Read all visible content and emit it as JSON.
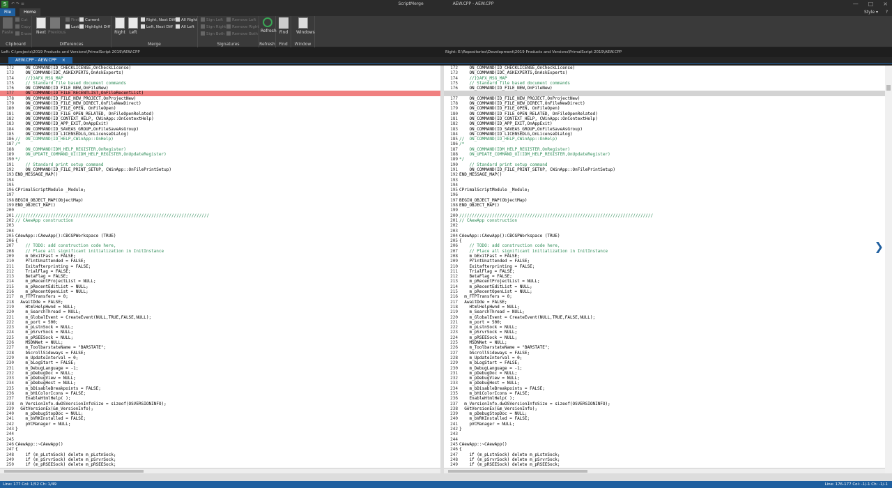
{
  "window": {
    "app_title": "ScriptMerge",
    "doc_title": "AEW.CPP - AEW.CPP",
    "qat": "↶ ↷ ≡"
  },
  "tabs": {
    "file": "File",
    "home": "Home",
    "style": "Style",
    "help": "?"
  },
  "ribbon": {
    "clipboard": {
      "label": "Clipboard",
      "paste": "Paste",
      "cut": "Cut",
      "copy": "Copy",
      "erase": "Erase"
    },
    "differences": {
      "label": "Differences",
      "next": "Next",
      "previous": "Previous",
      "first": "First",
      "last": "Last",
      "current": "Current",
      "highlight_diff": "Highlight Diff"
    },
    "merge": {
      "label": "Merge",
      "right": "Right",
      "left": "Left",
      "right_next_diff": "Right, Next Diff",
      "left_next_diff": "Left, Next Diff",
      "all_right": "All Right",
      "all_left": "All Left"
    },
    "signatures": {
      "label": "Signatures",
      "sign_left": "Sign Left",
      "sign_right": "Sign Right",
      "sign_both": "Sign Both",
      "remove_left": "Remove Left",
      "remove_right": "Remove Right",
      "remove_both": "Remove Both"
    },
    "refresh": {
      "label": "Refresh",
      "btn": "Refresh"
    },
    "find": {
      "label": "Find",
      "btn": "Find"
    },
    "window": {
      "label": "Window",
      "btn": "Windows"
    }
  },
  "paths": {
    "left": "Left: C:\\projects\\2019 Products and Versions\\PrimalScript 2019\\AEW.CPP",
    "right": "Right: E:\\Repositories\\Development\\2019 Products and Versions\\PrimalScript 2019\\AEW.CPP"
  },
  "doc_tab": {
    "label": "AEW.CPP - AEW.CPP",
    "close": "×"
  },
  "status": {
    "left": "Line: 177  Col: 1/52  Ch: 1/49",
    "right": "Line: 176-177  Col: -1/-1  Ch: -1/-1"
  },
  "left_lines": [
    {
      "n": "172",
      "t": "    ON_COMMAND(ID_CHECKLICENSE,OnCheckLicense)",
      "c": ""
    },
    {
      "n": "173",
      "t": "    ON_COMMAND(IDC_ASKEXPERTS,OnAskExperts)",
      "c": ""
    },
    {
      "n": "174",
      "t": "    //}}AFX_MSG_MAP",
      "c": "comment"
    },
    {
      "n": "175",
      "t": "    // Standard file based document commands",
      "c": "comment"
    },
    {
      "n": "176",
      "t": "    ON_COMMAND(ID_FILE_NEW,OnFileNew)",
      "c": ""
    },
    {
      "n": "177",
      "t": "    ON_COMMAND(ID_FILE_RECENTLIST,OnFileRecentList)",
      "c": "hl-red"
    },
    {
      "n": "178",
      "t": "    ON_COMMAND(ID_FILE_NEW_PROJECT,OnProjectNew)",
      "c": ""
    },
    {
      "n": "179",
      "t": "    ON_COMMAND(ID_FILE_NEW_DIRECT,OnFileNewDirect)",
      "c": ""
    },
    {
      "n": "180",
      "t": "    ON_COMMAND(ID_FILE_OPEN, OnFileOpen)",
      "c": ""
    },
    {
      "n": "181",
      "t": "    ON_COMMAND(ID_FILE_OPEN_RELATED, OnFileOpenRelated)",
      "c": ""
    },
    {
      "n": "182",
      "t": "    ON_COMMAND(ID_CONTEXT_HELP, CWinApp::OnContextHelp)",
      "c": ""
    },
    {
      "n": "183",
      "t": "    ON_COMMAND(ID_APP_EXIT,OnAppExit)",
      "c": ""
    },
    {
      "n": "184",
      "t": "    ON_COMMAND(ID_SAVEAS_GROUP,OnFileSaveAsGroup)",
      "c": ""
    },
    {
      "n": "185",
      "t": "    ON_COMMAND(ID_LICENSEDLG,OnLicenseDialog)",
      "c": ""
    },
    {
      "n": "186",
      "t": "//  ON_COMMAND(ID_HELP,CWinApp::OnHelp)",
      "c": "comment"
    },
    {
      "n": "187",
      "t": "/*",
      "c": "comment"
    },
    {
      "n": "188",
      "t": "    ON_COMMAND(IDM_HELP_REGISTER,OnRegister)",
      "c": "comment"
    },
    {
      "n": "189",
      "t": "    ON_UPDATE_COMMAND_UI(IDM_HELP_REGISTER,OnUpdateRegister)",
      "c": "comment"
    },
    {
      "n": "190",
      "t": "*/",
      "c": "comment"
    },
    {
      "n": "191",
      "t": "    // Standard print setup command",
      "c": "comment"
    },
    {
      "n": "192",
      "t": "    ON_COMMAND(ID_FILE_PRINT_SETUP, CWinApp::OnFilePrintSetup)",
      "c": ""
    },
    {
      "n": "193",
      "t": "END_MESSAGE_MAP()",
      "c": ""
    },
    {
      "n": "194",
      "t": "",
      "c": ""
    },
    {
      "n": "195",
      "t": "",
      "c": ""
    },
    {
      "n": "196",
      "t": "CPrimalScriptModule _Module;",
      "c": ""
    },
    {
      "n": "197",
      "t": "",
      "c": ""
    },
    {
      "n": "198",
      "t": "BEGIN_OBJECT_MAP(ObjectMap)",
      "c": ""
    },
    {
      "n": "199",
      "t": "END_OBJECT_MAP()",
      "c": ""
    },
    {
      "n": "200",
      "t": "",
      "c": ""
    },
    {
      "n": "201",
      "t": "/////////////////////////////////////////////////////////////////////////////",
      "c": "comment"
    },
    {
      "n": "202",
      "t": "// CAewApp construction",
      "c": "comment"
    },
    {
      "n": "203",
      "t": "",
      "c": ""
    },
    {
      "n": "204",
      "t": "",
      "c": ""
    },
    {
      "n": "205",
      "t": "CAewApp::CAewApp():CBCGPWorkspace (TRUE)",
      "c": ""
    },
    {
      "n": "206",
      "t": "{",
      "c": ""
    },
    {
      "n": "207",
      "t": "    // TODO: add construction code here,",
      "c": "comment"
    },
    {
      "n": "208",
      "t": "    // Place all significant initialization in InitInstance",
      "c": "comment"
    },
    {
      "n": "209",
      "t": "    m_bExitFast = FALSE;",
      "c": ""
    },
    {
      "n": "210",
      "t": "    PrintUnattended = FALSE;",
      "c": ""
    },
    {
      "n": "211",
      "t": "    Exitafterprinting = FALSE;",
      "c": ""
    },
    {
      "n": "212",
      "t": "    TrialFlag = FALSE;",
      "c": ""
    },
    {
      "n": "213",
      "t": "    BetaFlag = FALSE;",
      "c": ""
    },
    {
      "n": "214",
      "t": "    m_pRecentProjectList = NULL;",
      "c": ""
    },
    {
      "n": "215",
      "t": "    m_pRecentEditList = NULL;",
      "c": ""
    },
    {
      "n": "216",
      "t": "    m_pRecentOpenList = NULL;",
      "c": ""
    },
    {
      "n": "217",
      "t": "  m_FTPTransfers = 0;",
      "c": ""
    },
    {
      "n": "218",
      "t": "  AwaitDde = FALSE;",
      "c": ""
    },
    {
      "n": "219",
      "t": "    HtmlHelpHwnd = NULL;",
      "c": ""
    },
    {
      "n": "220",
      "t": "    m_SearchThread = NULL;",
      "c": ""
    },
    {
      "n": "221",
      "t": "    m_GlobalEvent = CreateEvent(NULL,TRUE,FALSE,NULL);",
      "c": ""
    },
    {
      "n": "222",
      "t": "    m_port = 500;",
      "c": ""
    },
    {
      "n": "223",
      "t": "    m_pLstnSock = NULL;",
      "c": ""
    },
    {
      "n": "224",
      "t": "    m_pSrvrSock = NULL;",
      "c": ""
    },
    {
      "n": "225",
      "t": "    m_pRSEESock = NULL;",
      "c": ""
    },
    {
      "n": "226",
      "t": "    MSDNNet = NULL;",
      "c": ""
    },
    {
      "n": "227",
      "t": "    m_ToolbarstateName = \"BARSTATE\";",
      "c": ""
    },
    {
      "n": "228",
      "t": "    bScrollSideways = FALSE;",
      "c": ""
    },
    {
      "n": "229",
      "t": "    m_UpdateInterval = 0;",
      "c": ""
    },
    {
      "n": "230",
      "t": "    m_bLogStart = FALSE;",
      "c": ""
    },
    {
      "n": "231",
      "t": "    m_DebugLanguage = -1;",
      "c": ""
    },
    {
      "n": "232",
      "t": "    m_pDebugDoc = NULL;",
      "c": ""
    },
    {
      "n": "233",
      "t": "    m_pDebugView = NULL;",
      "c": ""
    },
    {
      "n": "234",
      "t": "    m_pDebugHost = NULL;",
      "c": ""
    },
    {
      "n": "235",
      "t": "    m_bDisableBreakpoints = FALSE;",
      "c": ""
    },
    {
      "n": "236",
      "t": "    m_bHiColorIcons = FALSE;",
      "c": ""
    },
    {
      "n": "237",
      "t": "    EnableHtmlHelp( );",
      "c": ""
    },
    {
      "n": "238",
      "t": "  m_VersionInfo.dwOSVersionInfoSize = sizeof(OSVERSIONINFO);",
      "c": ""
    },
    {
      "n": "239",
      "t": "  GetVersionEx(&m_VersionInfo);",
      "c": ""
    },
    {
      "n": "240",
      "t": "    m_pDebugStopDoc = NULL;",
      "c": ""
    },
    {
      "n": "241",
      "t": "    m_bVRKInstalled = FALSE;",
      "c": ""
    },
    {
      "n": "242",
      "t": "    pVCManager = NULL;",
      "c": ""
    },
    {
      "n": "243",
      "t": "}",
      "c": ""
    },
    {
      "n": "244",
      "t": "",
      "c": ""
    },
    {
      "n": "245",
      "t": "",
      "c": ""
    },
    {
      "n": "246",
      "t": "CAewApp::~CAewApp()",
      "c": ""
    },
    {
      "n": "247",
      "t": "{",
      "c": ""
    },
    {
      "n": "248",
      "t": "    if (m_pLstnSock) delete m_pLstnSock;",
      "c": ""
    },
    {
      "n": "249",
      "t": "    if (m_pSrvrSock) delete m_pSrvrSock;",
      "c": ""
    },
    {
      "n": "250",
      "t": "    if (m_pRSEESock) delete m_pRSEESock;",
      "c": ""
    }
  ],
  "right_lines": [
    {
      "n": "172",
      "t": "    ON_COMMAND(ID_CHECKLICENSE,OnCheckLicense)",
      "c": ""
    },
    {
      "n": "173",
      "t": "    ON_COMMAND(IDC_ASKEXPERTS,OnAskExperts)",
      "c": ""
    },
    {
      "n": "174",
      "t": "    //}}AFX_MSG_MAP",
      "c": "comment"
    },
    {
      "n": "175",
      "t": "    // Standard file based document commands",
      "c": "comment"
    },
    {
      "n": "176",
      "t": "    ON_COMMAND(ID_FILE_NEW,OnFileNew)",
      "c": ""
    },
    {
      "n": "",
      "t": "",
      "c": "hl-gray"
    },
    {
      "n": "177",
      "t": "    ON_COMMAND(ID_FILE_NEW_PROJECT,OnProjectNew)",
      "c": ""
    },
    {
      "n": "178",
      "t": "    ON_COMMAND(ID_FILE_NEW_DIRECT,OnFileNewDirect)",
      "c": ""
    },
    {
      "n": "179",
      "t": "    ON_COMMAND(ID_FILE_OPEN, OnFileOpen)",
      "c": ""
    },
    {
      "n": "180",
      "t": "    ON_COMMAND(ID_FILE_OPEN_RELATED, OnFileOpenRelated)",
      "c": ""
    },
    {
      "n": "181",
      "t": "    ON_COMMAND(ID_CONTEXT_HELP, CWinApp::OnContextHelp)",
      "c": ""
    },
    {
      "n": "182",
      "t": "    ON_COMMAND(ID_APP_EXIT,OnAppExit)",
      "c": ""
    },
    {
      "n": "183",
      "t": "    ON_COMMAND(ID_SAVEAS_GROUP,OnFileSaveAsGroup)",
      "c": ""
    },
    {
      "n": "184",
      "t": "    ON_COMMAND(ID_LICENSEDLG,OnLicenseDialog)",
      "c": ""
    },
    {
      "n": "185",
      "t": "//  ON_COMMAND(ID_HELP,CWinApp::OnHelp)",
      "c": "comment"
    },
    {
      "n": "186",
      "t": "/*",
      "c": "comment"
    },
    {
      "n": "187",
      "t": "    ON_COMMAND(IDM_HELP_REGISTER,OnRegister)",
      "c": "comment"
    },
    {
      "n": "188",
      "t": "    ON_UPDATE_COMMAND_UI(IDM_HELP_REGISTER,OnUpdateRegister)",
      "c": "comment"
    },
    {
      "n": "189",
      "t": "*/",
      "c": "comment"
    },
    {
      "n": "190",
      "t": "    // Standard print setup command",
      "c": "comment"
    },
    {
      "n": "191",
      "t": "    ON_COMMAND(ID_FILE_PRINT_SETUP, CWinApp::OnFilePrintSetup)",
      "c": ""
    },
    {
      "n": "192",
      "t": "END_MESSAGE_MAP()",
      "c": ""
    },
    {
      "n": "193",
      "t": "",
      "c": ""
    },
    {
      "n": "194",
      "t": "",
      "c": ""
    },
    {
      "n": "195",
      "t": "CPrimalScriptModule _Module;",
      "c": ""
    },
    {
      "n": "196",
      "t": "",
      "c": ""
    },
    {
      "n": "197",
      "t": "BEGIN_OBJECT_MAP(ObjectMap)",
      "c": ""
    },
    {
      "n": "198",
      "t": "END_OBJECT_MAP()",
      "c": ""
    },
    {
      "n": "199",
      "t": "",
      "c": ""
    },
    {
      "n": "200",
      "t": "/////////////////////////////////////////////////////////////////////////////",
      "c": "comment"
    },
    {
      "n": "201",
      "t": "// CAewApp construction",
      "c": "comment"
    },
    {
      "n": "202",
      "t": "",
      "c": ""
    },
    {
      "n": "203",
      "t": "",
      "c": ""
    },
    {
      "n": "204",
      "t": "CAewApp::CAewApp():CBCGPWorkspace (TRUE)",
      "c": ""
    },
    {
      "n": "205",
      "t": "{",
      "c": ""
    },
    {
      "n": "206",
      "t": "    // TODO: add construction code here,",
      "c": "comment"
    },
    {
      "n": "207",
      "t": "    // Place all significant initialization in InitInstance",
      "c": "comment"
    },
    {
      "n": "208",
      "t": "    m_bExitFast = FALSE;",
      "c": ""
    },
    {
      "n": "209",
      "t": "    PrintUnattended = FALSE;",
      "c": ""
    },
    {
      "n": "210",
      "t": "    Exitafterprinting = FALSE;",
      "c": ""
    },
    {
      "n": "211",
      "t": "    TrialFlag = FALSE;",
      "c": ""
    },
    {
      "n": "212",
      "t": "    BetaFlag = FALSE;",
      "c": ""
    },
    {
      "n": "213",
      "t": "    m_pRecentProjectList = NULL;",
      "c": ""
    },
    {
      "n": "214",
      "t": "    m_pRecentEditList = NULL;",
      "c": ""
    },
    {
      "n": "215",
      "t": "    m_pRecentOpenList = NULL;",
      "c": ""
    },
    {
      "n": "216",
      "t": "  m_FTPTransfers = 0;",
      "c": ""
    },
    {
      "n": "217",
      "t": "  AwaitDde = FALSE;",
      "c": ""
    },
    {
      "n": "218",
      "t": "    HtmlHelpHwnd = NULL;",
      "c": ""
    },
    {
      "n": "219",
      "t": "    m_SearchThread = NULL;",
      "c": ""
    },
    {
      "n": "220",
      "t": "    m_GlobalEvent = CreateEvent(NULL,TRUE,FALSE,NULL);",
      "c": ""
    },
    {
      "n": "221",
      "t": "    m_port = 500;",
      "c": ""
    },
    {
      "n": "222",
      "t": "    m_pLstnSock = NULL;",
      "c": ""
    },
    {
      "n": "223",
      "t": "    m_pSrvrSock = NULL;",
      "c": ""
    },
    {
      "n": "224",
      "t": "    m_pRSEESock = NULL;",
      "c": ""
    },
    {
      "n": "225",
      "t": "    MSDNNet = NULL;",
      "c": ""
    },
    {
      "n": "226",
      "t": "    m_ToolbarstateName = \"BARSTATE\";",
      "c": ""
    },
    {
      "n": "227",
      "t": "    bScrollSideways = FALSE;",
      "c": ""
    },
    {
      "n": "228",
      "t": "    m_UpdateInterval = 0;",
      "c": ""
    },
    {
      "n": "229",
      "t": "    m_bLogStart = FALSE;",
      "c": ""
    },
    {
      "n": "230",
      "t": "    m_DebugLanguage = -1;",
      "c": ""
    },
    {
      "n": "231",
      "t": "    m_pDebugDoc = NULL;",
      "c": ""
    },
    {
      "n": "232",
      "t": "    m_pDebugView = NULL;",
      "c": ""
    },
    {
      "n": "233",
      "t": "    m_pDebugHost = NULL;",
      "c": ""
    },
    {
      "n": "234",
      "t": "    m_bDisableBreakpoints = FALSE;",
      "c": ""
    },
    {
      "n": "235",
      "t": "    m_bHiColorIcons = FALSE;",
      "c": ""
    },
    {
      "n": "236",
      "t": "    EnableHtmlHelp( );",
      "c": ""
    },
    {
      "n": "237",
      "t": "  m_VersionInfo.dwOSVersionInfoSize = sizeof(OSVERSIONINFO);",
      "c": ""
    },
    {
      "n": "238",
      "t": "  GetVersionEx(&m_VersionInfo);",
      "c": ""
    },
    {
      "n": "239",
      "t": "    m_pDebugStopDoc = NULL;",
      "c": ""
    },
    {
      "n": "240",
      "t": "    m_bVRKInstalled = FALSE;",
      "c": ""
    },
    {
      "n": "241",
      "t": "    pVCManager = NULL;",
      "c": ""
    },
    {
      "n": "242",
      "t": "}",
      "c": ""
    },
    {
      "n": "243",
      "t": "",
      "c": ""
    },
    {
      "n": "244",
      "t": "",
      "c": ""
    },
    {
      "n": "245",
      "t": "CAewApp::~CAewApp()",
      "c": ""
    },
    {
      "n": "246",
      "t": "{",
      "c": ""
    },
    {
      "n": "247",
      "t": "    if (m_pLstnSock) delete m_pLstnSock;",
      "c": ""
    },
    {
      "n": "248",
      "t": "    if (m_pSrvrSock) delete m_pSrvrSock;",
      "c": ""
    },
    {
      "n": "249",
      "t": "    if (m_pRSEESock) delete m_pRSEESock;",
      "c": ""
    }
  ],
  "colors": {
    "accent": "#1f5f9f",
    "diff_removed": "#f08080",
    "diff_placeholder": "#d3d3d3",
    "comment": "#2e8b57"
  }
}
